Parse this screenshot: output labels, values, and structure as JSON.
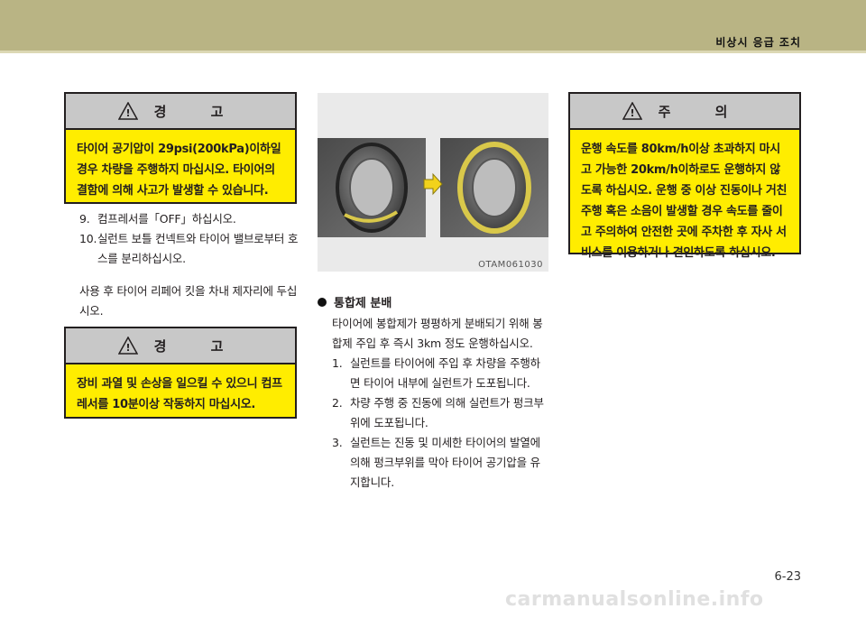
{
  "header": {
    "section_title": "비상시 응급 조치"
  },
  "warning1": {
    "title": "경 고",
    "text": "타이어 공기압이 29psi(200kPa)이하일 경우 차량을 주행하지 마십시오. 타이어의 결함에 의해 사고가 발생할 수 있습니다."
  },
  "steps_left": [
    {
      "num": "9.",
      "text": "컴프레서를「OFF」하십시오."
    },
    {
      "num": "10.",
      "text": "실런트 보틀 컨넥트와 타이어 밸브로부터 호스를 분리하십시오."
    }
  ],
  "after_use": "사용 후 타이어 리페어 킷을 차내 제자리에 두십시오.",
  "warning2": {
    "title": "경 고",
    "text": "장비 과열 및 손상을 일으킬 수 있으니 컴프레서를 10분이상 작동하지 마십시오."
  },
  "figure": {
    "code": "OTAM061030"
  },
  "sealant": {
    "heading": "통합제 분배",
    "intro": "타이어에 봉합제가 평평하게 분배되기 위해 봉합제 주입 후 즉시 3km 정도 운행하십시오.",
    "steps": [
      {
        "num": "1.",
        "text": "실런트를 타이어에 주입 후 차량을 주행하면 타이어 내부에 실런트가 도포됩니다."
      },
      {
        "num": "2.",
        "text": "차량 주행 중 진동에 의해 실런트가 펑크부위에 도포됩니다."
      },
      {
        "num": "3.",
        "text": "실런트는 진동 및 미세한 타이어의 발열에 의해 펑크부위를 막아 타이어 공기압을 유지합니다."
      }
    ]
  },
  "caution": {
    "title": "주 의",
    "text": "운행 속도를 80km/h이상 초과하지 마시고 가능한 20km/h이하로도 운행하지 않도록 하십시오. 운행 중 이상 진동이나 거친 주행 혹은 소음이 발생할 경우 속도를 줄이고 주의하여 안전한 곳에 주차한 후 자사 서비스를 이용하거나 견인하도록 하십시오."
  },
  "page_number": "6-23",
  "watermark": "carmanualsonline.info"
}
